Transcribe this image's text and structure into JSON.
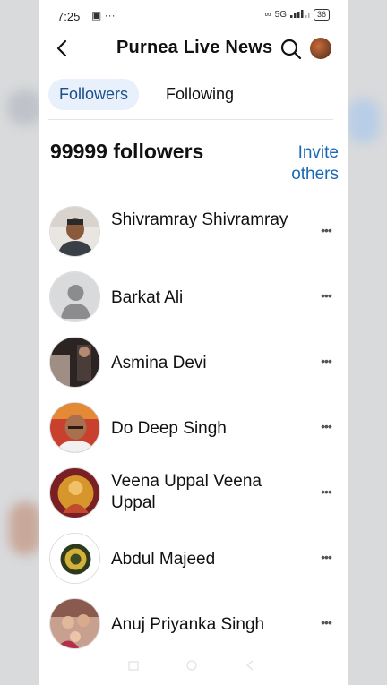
{
  "status_bar": {
    "time": "7:25",
    "left_icons": "▣ ···",
    "network": "5G",
    "battery": "36"
  },
  "header": {
    "title": "Purnea Live News"
  },
  "tabs": [
    {
      "label": "Followers",
      "active": true
    },
    {
      "label": "Following",
      "active": false
    }
  ],
  "summary": {
    "followers_count": "99999 followers",
    "invite_label": "Invite others"
  },
  "followers": [
    {
      "name": "Shivramray Shivramray",
      "avatar": "man-photo-avatar"
    },
    {
      "name": "Barkat Ali",
      "avatar": "default-person-avatar"
    },
    {
      "name": "Asmina Devi",
      "avatar": "photo-avatar"
    },
    {
      "name": "Do Deep Singh",
      "avatar": "man-photo-avatar"
    },
    {
      "name": "Veena Uppal Veena Uppal",
      "avatar": "deity-image-avatar"
    },
    {
      "name": "Abdul Majeed",
      "avatar": "emblem-avatar"
    },
    {
      "name": "Anuj Priyanka Singh",
      "avatar": "family-photo-avatar"
    }
  ],
  "colors": {
    "accent": "#1a68b8",
    "active_tab_bg": "#e8f1fb"
  }
}
